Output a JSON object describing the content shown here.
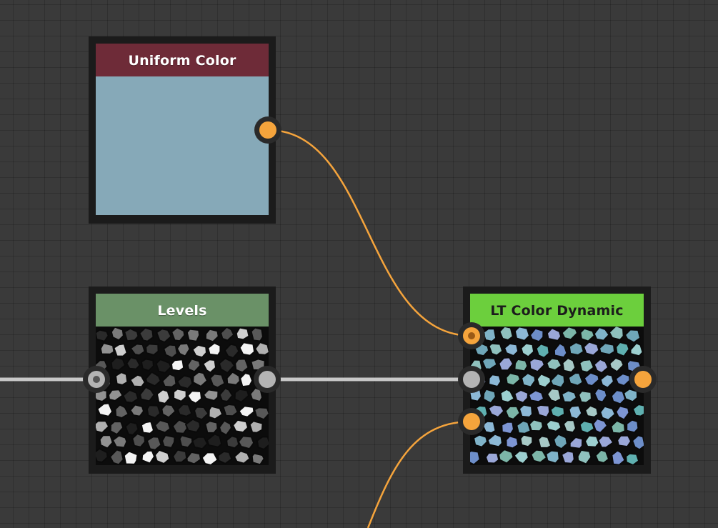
{
  "graph": {
    "nodes": [
      {
        "id": "uniform_color",
        "title": "Uniform Color",
        "header_color": "#6e2b38",
        "preview_color": "#86a9b8"
      },
      {
        "id": "levels",
        "title": "Levels",
        "header_color": "#6a9167",
        "preview": "grayscale cell pattern"
      },
      {
        "id": "lt_color_dynamic",
        "title": "LT Color Dynamic",
        "header_color": "#6ccf3d",
        "preview": "blue-teal cell pattern"
      }
    ],
    "connections": [
      {
        "from": "uniform_color.output",
        "to": "lt_color_dynamic.color_input",
        "type": "color",
        "color": "#f5a43c"
      },
      {
        "from": "offscreen_left",
        "to": "levels.input",
        "type": "grayscale",
        "color": "#c8c8c8"
      },
      {
        "from": "levels.output",
        "to": "lt_color_dynamic.grayscale_input",
        "type": "grayscale",
        "color": "#c8c8c8"
      },
      {
        "from": "offscreen_bottom",
        "to": "lt_color_dynamic.color_input_2",
        "type": "color",
        "color": "#f5a43c"
      }
    ],
    "port_colors": {
      "color": "#f5a43c",
      "grayscale": "#b4b4b4"
    }
  },
  "canvas": {
    "background": "#3a3a3a"
  }
}
